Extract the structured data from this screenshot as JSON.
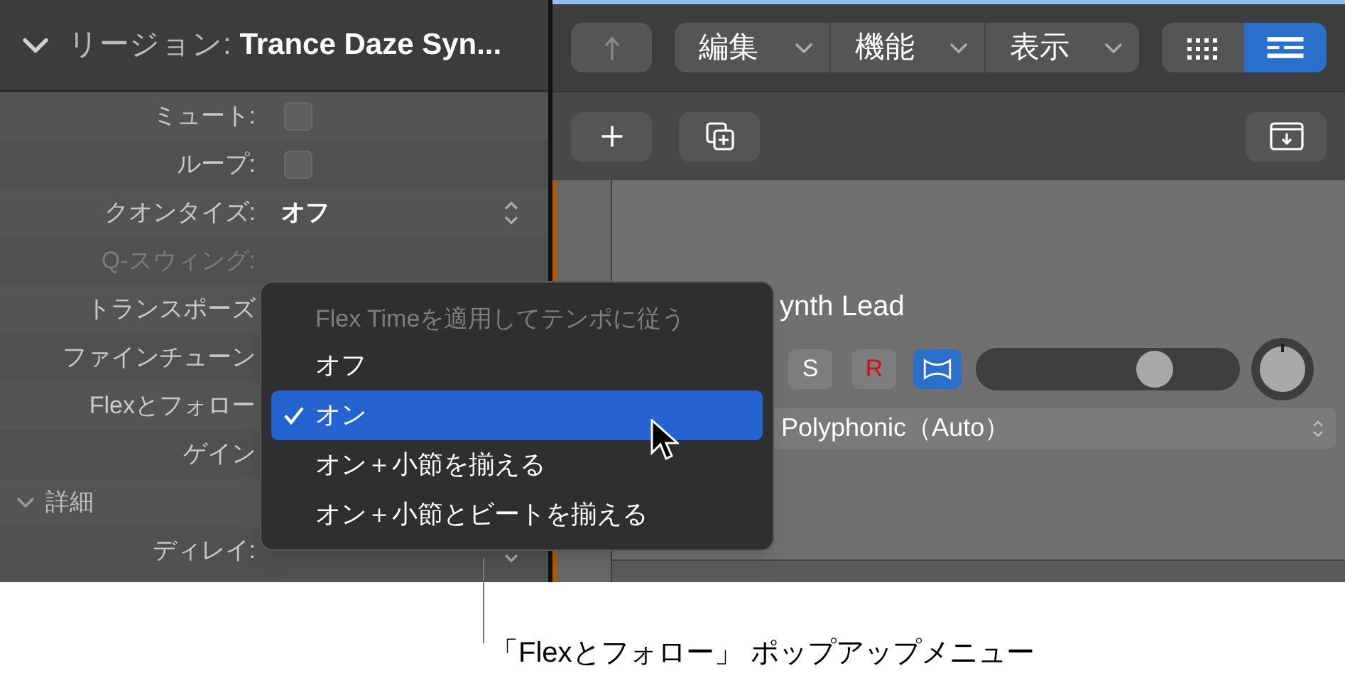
{
  "inspector": {
    "expanded": true,
    "title_label": "リージョン:",
    "title_value": "Trance Daze Syn...",
    "rows": [
      {
        "kind": "checkbox",
        "label": "ミュート:",
        "checked": false
      },
      {
        "kind": "checkbox",
        "label": "ループ:",
        "checked": false
      },
      {
        "kind": "popup",
        "label": "クオンタイズ:",
        "value": "オフ"
      },
      {
        "kind": "label",
        "label": "Q-スウィング:",
        "disabled": true
      },
      {
        "kind": "label",
        "label": "トランスポーズ",
        "disabled": false
      },
      {
        "kind": "label",
        "label": "ファインチューン",
        "disabled": false
      },
      {
        "kind": "label",
        "label": "Flexとフォロー",
        "disabled": false
      },
      {
        "kind": "label",
        "label": "ゲイン",
        "disabled": false
      },
      {
        "kind": "section",
        "label": "詳細",
        "expanded": true
      },
      {
        "kind": "popup",
        "label": "ディレイ:"
      }
    ]
  },
  "toolbar": {
    "menus": [
      "編集",
      "機能",
      "表示"
    ],
    "views": [
      {
        "kind": "grid",
        "selected": false
      },
      {
        "kind": "list",
        "selected": true
      }
    ]
  },
  "track": {
    "name": "ynth Lead",
    "buttons": [
      {
        "kind": "solo",
        "label": "S"
      },
      {
        "kind": "record",
        "label": "R"
      }
    ],
    "flex_on": true,
    "volume": {
      "level": 0.68
    },
    "mode": "Polyphonic（Auto）"
  },
  "popup_menu": {
    "header": "Flex Timeを適用してテンポに従う",
    "items": [
      {
        "label": "オフ",
        "selected": false
      },
      {
        "label": "オン",
        "selected": true
      },
      {
        "label": "オン＋小節を揃える",
        "selected": false
      },
      {
        "label": "オン＋小節とビートを揃える",
        "selected": false
      }
    ]
  },
  "callout": "「Flexとフォロー」 ポップアップメニュー"
}
